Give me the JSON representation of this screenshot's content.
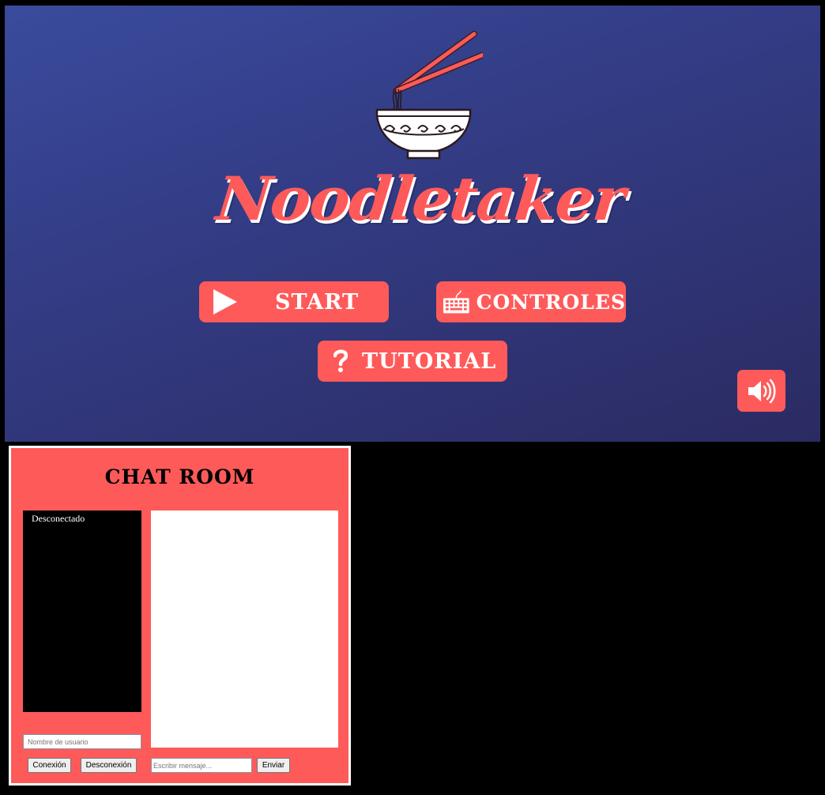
{
  "game": {
    "title": "Noodletaker",
    "logo_icon": "noodle-bowl-with-chopsticks",
    "buttons": {
      "start": {
        "label": "START",
        "icon": "play-icon"
      },
      "controles": {
        "label": "CONTROLES",
        "icon": "keyboard-icon"
      },
      "tutorial": {
        "label": "TUTORIAL",
        "icon": "question-icon"
      },
      "sound": {
        "icon": "speaker-icon"
      }
    },
    "colors": {
      "accent": "#ff5a5a",
      "background_top": "#3a4b9d",
      "background_bottom": "#2b2b62",
      "text": "#ffffff"
    }
  },
  "chat": {
    "title": "CHAT ROOM",
    "status": "Desconectado",
    "username_placeholder": "Nombre de usuario",
    "message_placeholder": "Escribir mensaje...",
    "connect_label": "Conexión",
    "disconnect_label": "Desconexión",
    "send_label": "Enviar",
    "colors": {
      "panel": "#ff5a5a",
      "user_list_bg": "#000000",
      "messages_bg": "#ffffff"
    }
  }
}
